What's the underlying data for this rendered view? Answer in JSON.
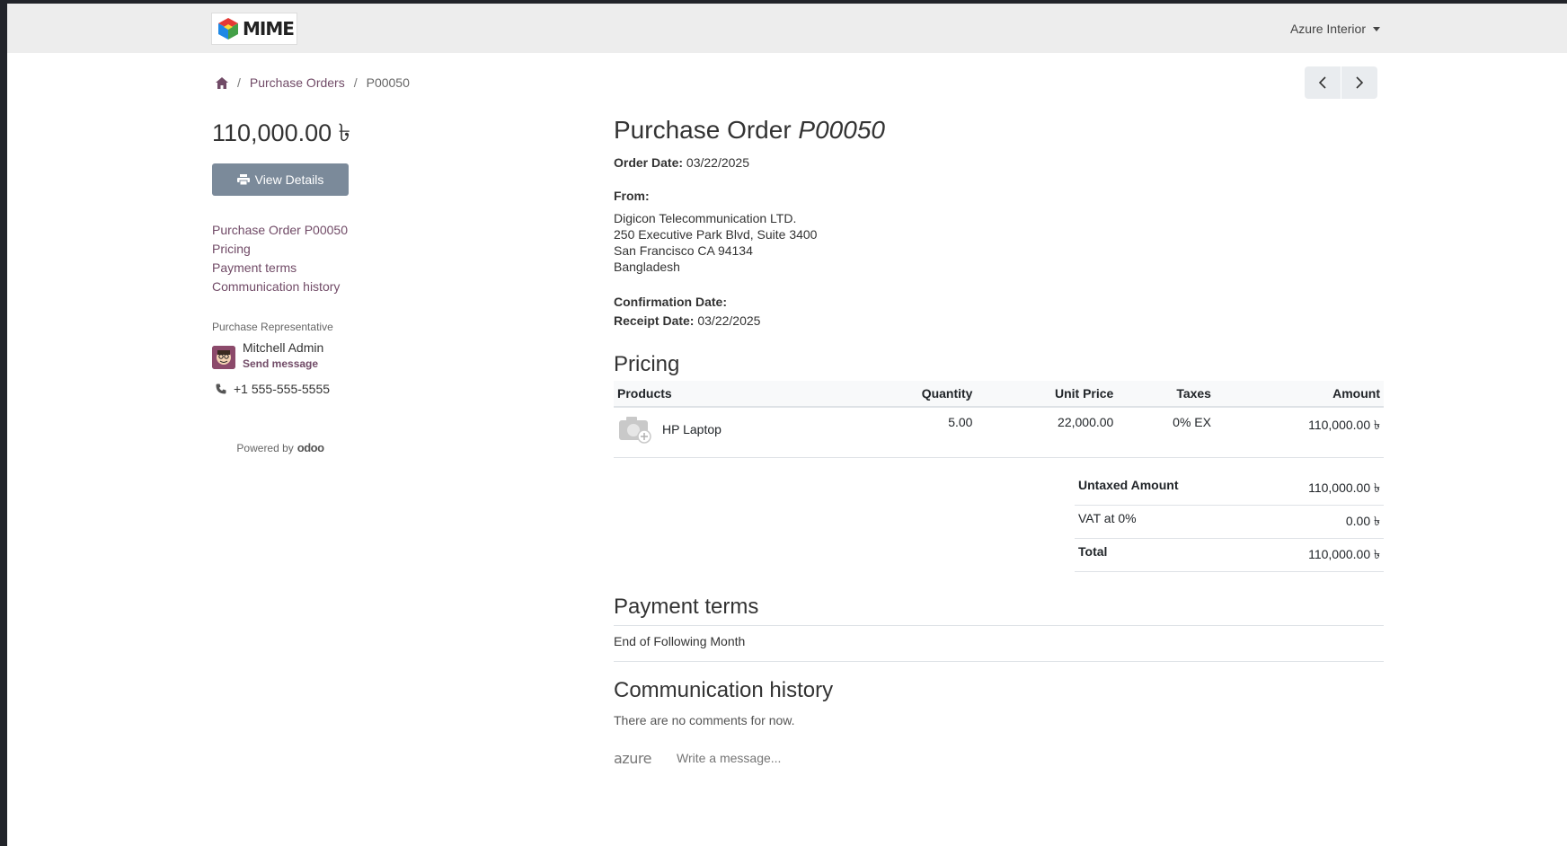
{
  "header": {
    "logo_text": "MIME",
    "company_menu": "Azure Interior"
  },
  "breadcrumb": {
    "parent": "Purchase Orders",
    "current": "P00050"
  },
  "sidebar": {
    "amount": "110,000.00 ৳",
    "view_details": "View Details",
    "toc": [
      "Purchase Order P00050",
      "Pricing",
      "Payment terms",
      "Communication history"
    ],
    "rep_label": "Purchase Representative",
    "rep_name": "Mitchell Admin",
    "send_message": "Send message",
    "phone": "+1 555-555-5555",
    "powered_by": "Powered by",
    "odoo": "odoo"
  },
  "order": {
    "title": "Purchase Order",
    "number": "P00050",
    "order_date_label": "Order Date:",
    "order_date": "03/22/2025",
    "from_label": "From:",
    "vendor_lines": [
      "Digicon Telecommunication LTD.",
      "250 Executive Park Blvd, Suite 3400",
      "San Francisco CA 94134",
      "Bangladesh"
    ],
    "confirmation_label": "Confirmation Date:",
    "receipt_label": "Receipt Date:",
    "receipt_date": "03/22/2025"
  },
  "pricing": {
    "heading": "Pricing",
    "columns": [
      "Products",
      "Quantity",
      "Unit Price",
      "Taxes",
      "Amount"
    ],
    "rows": [
      {
        "product": "HP Laptop",
        "quantity": "5.00",
        "unit_price": "22,000.00",
        "taxes": "0% EX",
        "amount": "110,000.00 ৳"
      }
    ],
    "untaxed_label": "Untaxed Amount",
    "untaxed_value": "110,000.00 ৳",
    "vat_label": "VAT at 0%",
    "vat_value": "0.00 ৳",
    "total_label": "Total",
    "total_value": "110,000.00 ৳"
  },
  "payment": {
    "heading": "Payment terms",
    "text": "End of Following Month"
  },
  "communication": {
    "heading": "Communication history",
    "empty": "There are no comments for now.",
    "logo_text": "azure",
    "placeholder": "Write a message..."
  }
}
